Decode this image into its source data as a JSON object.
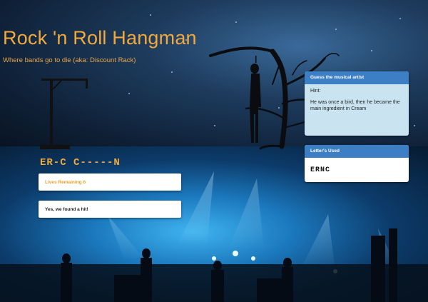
{
  "header": {
    "title": "Rock 'n Roll Hangman",
    "subtitle": "Where bands go to die (aka: Discount Rack)"
  },
  "game": {
    "masked_word": "ER-C C-----N",
    "lives_text": "Lives Remaining 6",
    "result_text": "Yes, we found a hit!"
  },
  "hint_panel": {
    "header": "Guess the musical artist",
    "label": "Hint:",
    "text": "He was once a bird, then he became the main ingredient in Cream"
  },
  "used_panel": {
    "header": "Letter's Used",
    "letters": "ERNC"
  },
  "colors": {
    "accent_orange": "#f2a93b",
    "panel_blue": "#3d7fc4",
    "hint_bg": "#c9e4f0"
  },
  "icons": [
    "gallows-icon",
    "hanging-figure-icon",
    "dead-tree-icon"
  ]
}
